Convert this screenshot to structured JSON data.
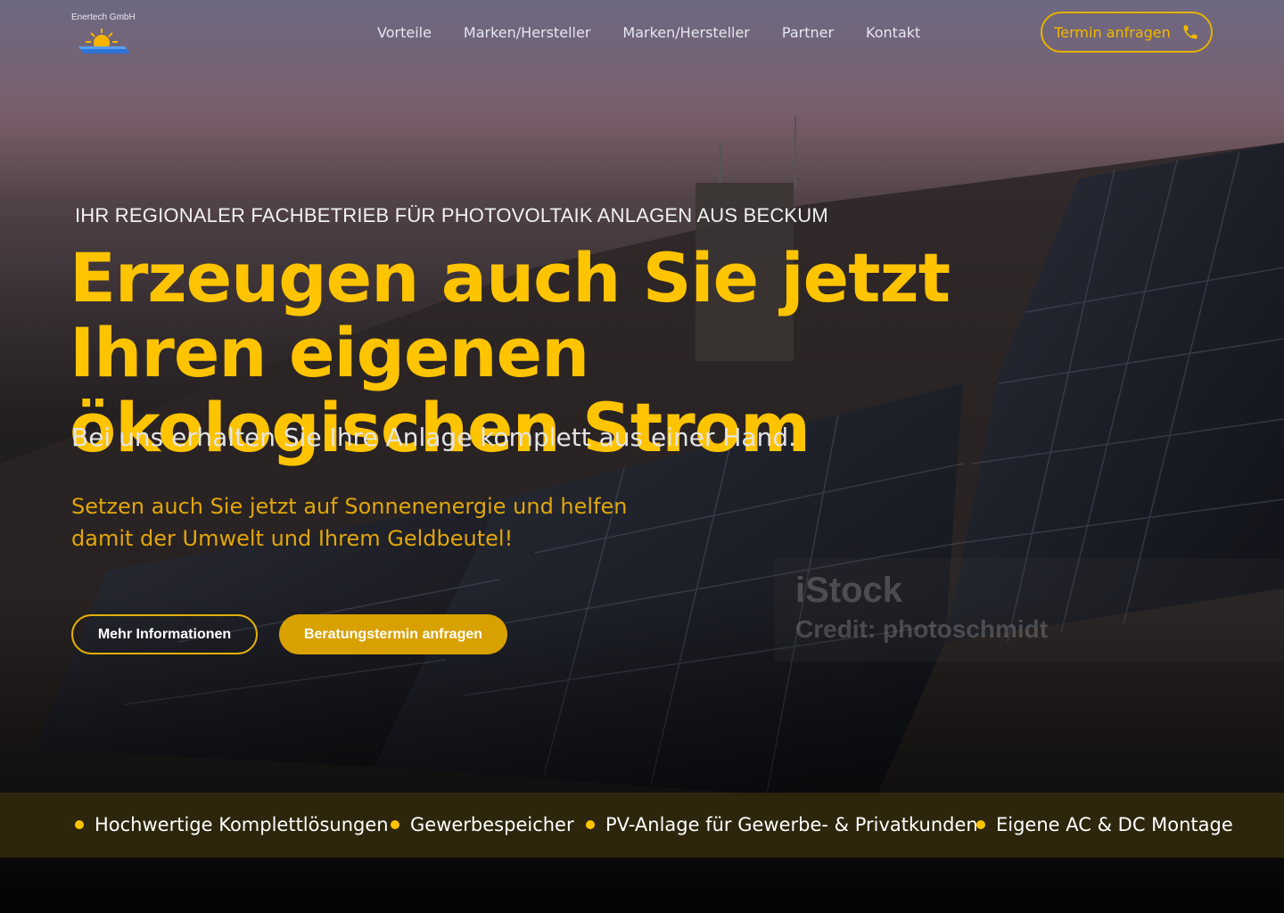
{
  "header": {
    "logo_text": "Enertech GmbH",
    "nav": [
      "Vorteile",
      "Marken/Hersteller",
      "Marken/Hersteller",
      "Partner",
      "Kontakt"
    ],
    "cta_label": "Termin anfragen",
    "cta_icon": "phone-icon"
  },
  "hero": {
    "eyebrow": "IHR REGIONALER FACHBETRIEB FÜR PHOTOVOLTAIK ANLAGEN AUS BECKUM",
    "headline": "Erzeugen auch Sie jetzt Ihren eigenen ökologischen Strom",
    "subline": "Bei uns erhalten Sie Ihre Anlage komplett aus einer Hand.",
    "paragraph": "Setzen auch Sie jetzt auf Sonnenenergie und helfen damit der Umwelt und Ihrem Geldbeutel!",
    "button_more": "Mehr Informationen",
    "button_consult": "Beratungstermin anfragen",
    "watermark_brand": "iStock",
    "watermark_credit": "Credit: photoschmidt"
  },
  "features": [
    "Hochwertige Komplettlösungen",
    "Gewerbespeicher",
    "PV-Anlage für Gewerbe- & Privatkunden",
    "Eigene AC & DC Montage"
  ],
  "colors": {
    "accent": "#ffc400",
    "accent_dark": "#d9a100",
    "strip_bg": "#342c0c",
    "text_muted": "#e0a60b"
  }
}
